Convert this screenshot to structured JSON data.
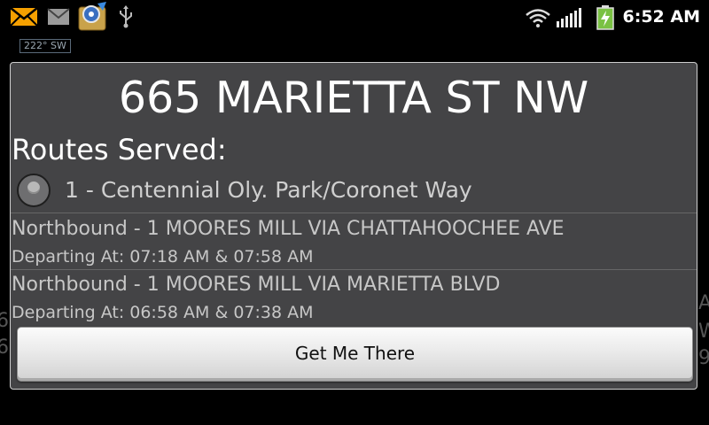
{
  "statusbar": {
    "icons": [
      "mail-icon",
      "email-icon",
      "app-icon",
      "usb-icon",
      "wifi-icon",
      "signal-icon",
      "battery-icon"
    ],
    "time": "6:52 AM"
  },
  "map": {
    "compass": "222° SW"
  },
  "dialog": {
    "title": "665 MARIETTA ST NW",
    "routes_heading": "Routes Served:",
    "route": {
      "label": "1 - Centennial Oly. Park/Coronet Way"
    },
    "trips": [
      {
        "direction": "Northbound - 1 MOORES MILL VIA CHATTAHOOCHEE AVE",
        "departing": "Departing At: 07:18 AM & 07:58 AM"
      },
      {
        "direction": "Northbound - 1 MOORES MILL VIA MARIETTA BLVD",
        "departing": "Departing At: 06:58 AM & 07:38 AM"
      }
    ],
    "button_label": "Get Me There"
  },
  "colors": {
    "dialog_bg": "#444446",
    "battery": "#7ac143",
    "mail_icon": "#f5a000"
  }
}
